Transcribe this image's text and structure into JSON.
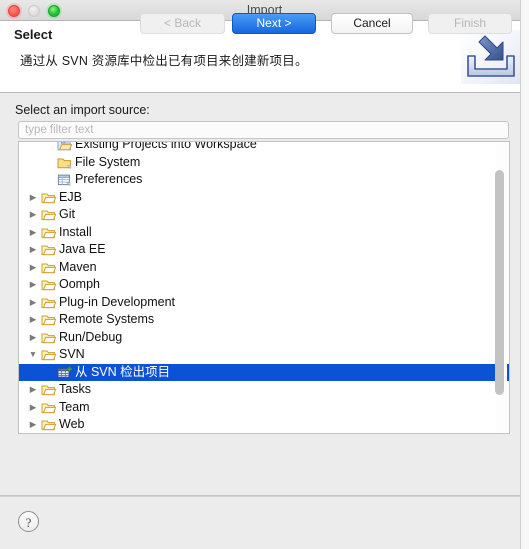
{
  "window": {
    "title": "Import",
    "traffic_lights": [
      "close-button",
      "minimize-button",
      "maximize-button"
    ]
  },
  "header": {
    "title": "Select",
    "description": "通过从 SVN 资源库中检出已有项目来创建新项目。",
    "icon": "import-wizard-icon"
  },
  "body": {
    "source_label": "Select an import source:",
    "filter_placeholder": "type filter text",
    "filter_value": ""
  },
  "tree": {
    "selected_index": 13,
    "items": [
      {
        "label": "Existing Projects into Workspace",
        "depth": 1,
        "twisty": "",
        "icon": "import-projects-icon",
        "selected": false
      },
      {
        "label": "File System",
        "depth": 1,
        "twisty": "",
        "icon": "folder-icon",
        "selected": false
      },
      {
        "label": "Preferences",
        "depth": 1,
        "twisty": "",
        "icon": "preferences-icon",
        "selected": false
      },
      {
        "label": "EJB",
        "depth": 0,
        "twisty": "▶",
        "icon": "folder-open-icon",
        "selected": false
      },
      {
        "label": "Git",
        "depth": 0,
        "twisty": "▶",
        "icon": "folder-open-icon",
        "selected": false
      },
      {
        "label": "Install",
        "depth": 0,
        "twisty": "▶",
        "icon": "folder-open-icon",
        "selected": false
      },
      {
        "label": "Java EE",
        "depth": 0,
        "twisty": "▶",
        "icon": "folder-open-icon",
        "selected": false
      },
      {
        "label": "Maven",
        "depth": 0,
        "twisty": "▶",
        "icon": "folder-open-icon",
        "selected": false
      },
      {
        "label": "Oomph",
        "depth": 0,
        "twisty": "▶",
        "icon": "folder-open-icon",
        "selected": false
      },
      {
        "label": "Plug-in Development",
        "depth": 0,
        "twisty": "▶",
        "icon": "folder-open-icon",
        "selected": false
      },
      {
        "label": "Remote Systems",
        "depth": 0,
        "twisty": "▶",
        "icon": "folder-open-icon",
        "selected": false
      },
      {
        "label": "Run/Debug",
        "depth": 0,
        "twisty": "▶",
        "icon": "folder-open-icon",
        "selected": false
      },
      {
        "label": "SVN",
        "depth": 0,
        "twisty": "▼",
        "icon": "folder-open-icon",
        "selected": false
      },
      {
        "label": "从 SVN 检出项目",
        "depth": 1,
        "twisty": "",
        "icon": "svn-checkout-icon",
        "selected": true
      },
      {
        "label": "Tasks",
        "depth": 0,
        "twisty": "▶",
        "icon": "folder-open-icon",
        "selected": false
      },
      {
        "label": "Team",
        "depth": 0,
        "twisty": "▶",
        "icon": "folder-open-icon",
        "selected": false
      },
      {
        "label": "Web",
        "depth": 0,
        "twisty": "▶",
        "icon": "folder-open-icon",
        "selected": false
      }
    ]
  },
  "footer": {
    "help_label": "?",
    "back_label": "< Back",
    "next_label": "Next >",
    "cancel_label": "Cancel",
    "finish_label": "Finish",
    "back_enabled": false,
    "next_enabled": true,
    "cancel_enabled": true,
    "finish_enabled": false
  },
  "colors": {
    "selection_blue": "#0b52d4",
    "primary_button_blue": "#1667dd",
    "window_chrome": "#ececec",
    "close_red": "#ff5f57",
    "maximize_green": "#28c840"
  }
}
